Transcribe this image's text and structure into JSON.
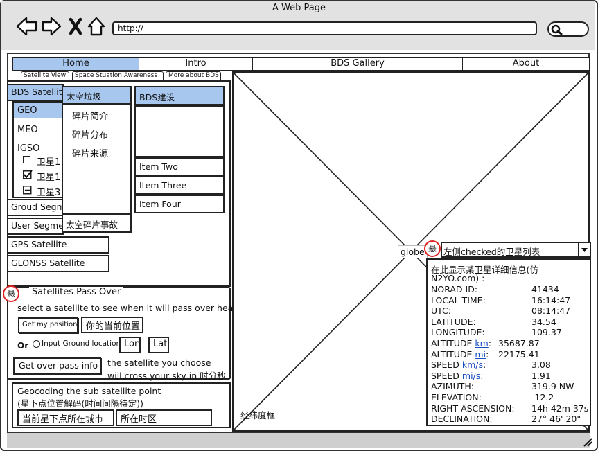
{
  "window": {
    "title": "A Web Page",
    "url": "http://"
  },
  "nav": {
    "tabs": [
      "Home",
      "Intro",
      "BDS Gallery",
      "About"
    ]
  },
  "subtabs": [
    "Satellite View",
    "Space Stuation Awareness",
    "More about BDS"
  ],
  "sidebar": {
    "bds_satellite": "BDS Satellite",
    "geo": "GEO",
    "meo": "MEO",
    "igso": "IGSO",
    "satellites": [
      {
        "label": "卫星1",
        "state": "unchecked"
      },
      {
        "label": "卫星1",
        "state": "checked"
      },
      {
        "label": "卫星3",
        "state": "indeterminate"
      }
    ],
    "ground_segment": "Groud Segment",
    "user_segment": "User Segment",
    "gps": "GPS Satellite",
    "glonss": "GLONSS Satellite"
  },
  "debris_menu": {
    "header": "太空垃圾",
    "items": [
      "碎片简介",
      "碎片分布",
      "碎片来源"
    ],
    "footer": "太空碎片事故"
  },
  "bds_menu": {
    "header": "BDS建设",
    "items": [
      "Item Two",
      "Item Three",
      "Item Four"
    ]
  },
  "pass_over": {
    "title": "Satellites Pass Over",
    "pin_label": "悬",
    "instruction": "select a satellite to see when it will pass over head",
    "get_position_button": "Get my position",
    "current_position_label": "你的当前位置",
    "or_label": "Or",
    "radio_label": "Input Ground location",
    "lon_label": "Lon",
    "lat_label": "Lat",
    "get_pass_button": "Get over pass info",
    "result_line1": "the satellite you choose",
    "result_line2": "will cross your sky in 时分秒"
  },
  "geocoding": {
    "title": "Geocoding the sub satellite point",
    "subtitle": "(星下点位置解码(时间间隔待定))",
    "city_field": "当前星下点所在城市",
    "timezone_field": "所在时区"
  },
  "map": {
    "globe_label": "globe",
    "bottom_label": "经纬度框",
    "pin_label": "悬",
    "satellite_select": "左侧checked的卫星列表"
  },
  "satellite_info": {
    "header_line1": "在此显示某卫星详细信息(仿",
    "header_line2": "N2YO.com) :",
    "rows": [
      {
        "label": "NORAD ID:",
        "value": "41434"
      },
      {
        "label": "LOCAL TIME:",
        "value": "16:14:47"
      },
      {
        "label": "UTC:",
        "value": "08:14:47"
      },
      {
        "label": "LATITUDE:",
        "value": "34.54"
      },
      {
        "label": "LONGITUDE:",
        "value": "109.37"
      }
    ],
    "altitude_km": {
      "label": "ALTITUDE",
      "unit": "km",
      "value": "35687.87"
    },
    "altitude_mi": {
      "label": "ALTITUDE",
      "unit": "mi",
      "value": "22175.41"
    },
    "speed_kms": {
      "label": "SPEED",
      "unit": "km/s",
      "value": "3.08"
    },
    "speed_mis": {
      "label": "SPEED",
      "unit": "mi/s",
      "value": "1.91"
    },
    "rows2": [
      {
        "label": "AZIMUTH:",
        "value": "319.9 NW"
      },
      {
        "label": "ELEVATION:",
        "value": "-12.2"
      },
      {
        "label": "RIGHT ASCENSION:",
        "value": "14h 42m 37s"
      },
      {
        "label": "DECLINATION:",
        "value": "27° 46' 20\""
      }
    ]
  }
}
